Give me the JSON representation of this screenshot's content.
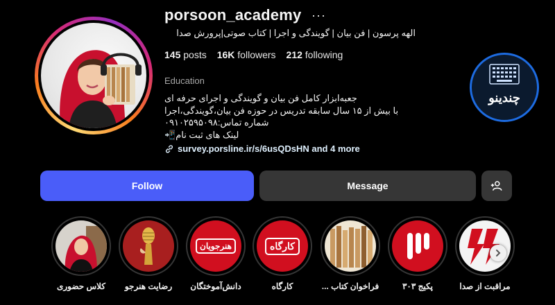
{
  "profile": {
    "username": "porsoon_academy",
    "more_icon": "more-horizontal-icon",
    "full_name": "الهه پرسون | فن بیان | گویندگی و اجرا | کتاب صوتی|پرورش صدا",
    "stats": {
      "posts_count": "145",
      "posts_label": "posts",
      "followers_count": "16K",
      "followers_label": "followers",
      "following_count": "212",
      "following_label": "following"
    },
    "category": "Education",
    "bio_lines": [
      "جعبه‌ابزار کامل فن بیان و گویندگی و اجرای حرفه ای",
      "با بیش از ۱۵ سال سابقه تدریس در حوزه فن بیان،گویندگی،اجرا",
      "شماره تماس:۰۹۱۰۲۵۹۵۰۹۸",
      "لینک های ثبت نام📲"
    ],
    "link_text": "survey.porsline.ir/s/6usQDsHN and 4 more",
    "link_icon": "link-icon"
  },
  "actions": {
    "follow_label": "Follow",
    "message_label": "Message",
    "suggest_icon": "add-person-icon"
  },
  "brand_badge": {
    "text": "چند‌ینو",
    "accent": "#1d6be0"
  },
  "highlights": [
    {
      "label": "کلاس حضوری",
      "icon": "portrait-photo"
    },
    {
      "label": "رضایت هنرجو",
      "icon": "microphone-icon"
    },
    {
      "label": "دانش‌آموختگان",
      "icon": "badge-text",
      "badge": "هنرجویان"
    },
    {
      "label": "کارگاه",
      "icon": "badge-text",
      "badge": "کارگاه"
    },
    {
      "label": "فراخوان کتاب ...",
      "icon": "books-photo"
    },
    {
      "label": "پکیج ۳۰۳",
      "icon": "bars-logo"
    },
    {
      "label": "مراقبت از صدا",
      "icon": "lightning-icon"
    }
  ],
  "colors": {
    "follow_button": "#4a5df9",
    "secondary_button": "#363636",
    "brand_red": "#c8102e",
    "muted_text": "#a8a8a8"
  }
}
